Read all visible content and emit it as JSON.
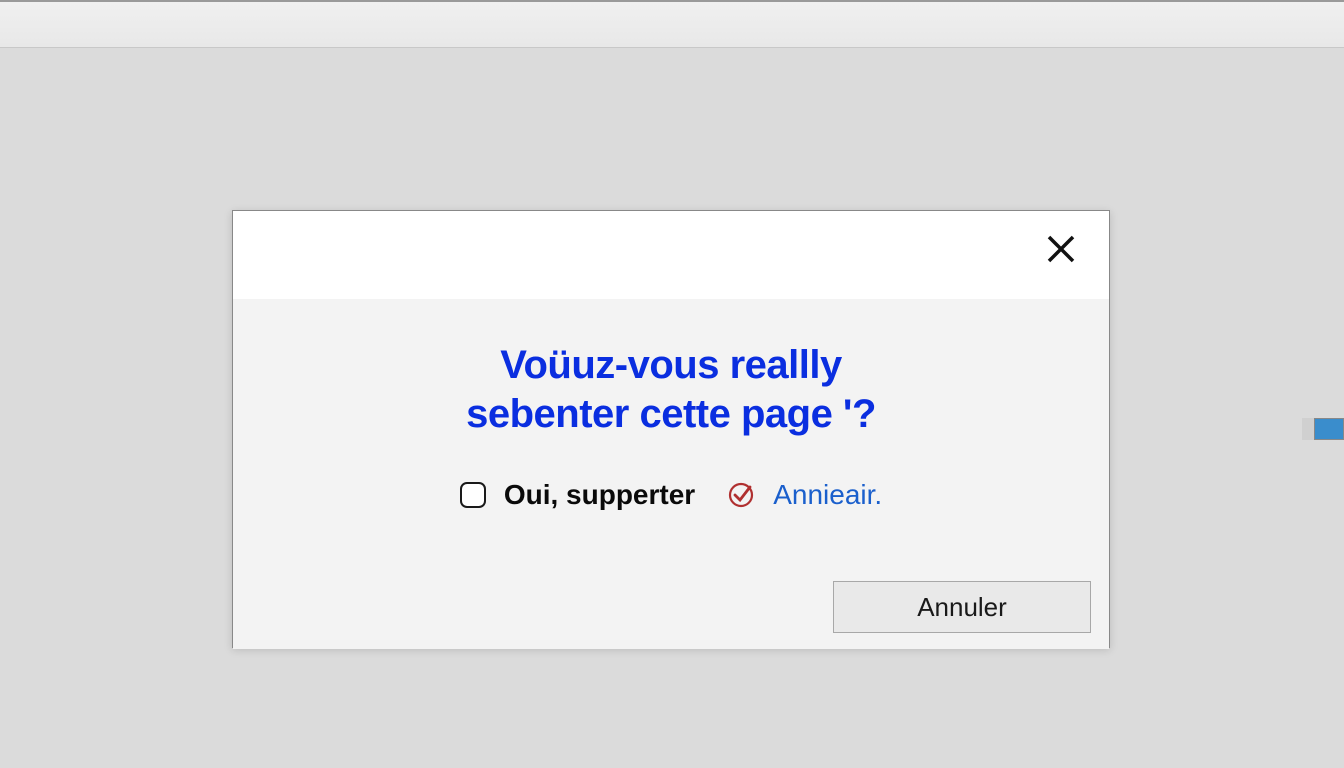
{
  "dialog": {
    "title_line1": "Voüuz-vous reallly",
    "title_line2": "sebenter cette page '?",
    "options": {
      "opt1_label": "Oui, supperter",
      "opt2_label": "Annieair."
    },
    "cancel_label": "Annuler"
  }
}
